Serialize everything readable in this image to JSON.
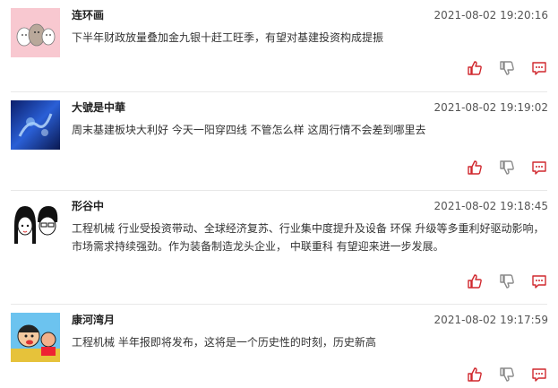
{
  "comments": [
    {
      "user": "连环画",
      "time": "2021-08-02 19:20:16",
      "text": "下半年财政放量叠加金九银十赶工旺季，有望对基建投资构成提振"
    },
    {
      "user": "大號是中華",
      "time": "2021-08-02 19:19:02",
      "text": "周末基建板块大利好 今天一阳穿四线 不管怎么样 这周行情不会差到哪里去"
    },
    {
      "user": "形谷中",
      "time": "2021-08-02 19:18:45",
      "text_line1": "工程机械 行业受投资带动、全球经济复苏、行业集中度提升及设备 环保 升级等多重利好驱动影响，",
      "text_line2": "市场需求持续强劲。作为装备制造龙头企业， 中联重科 有望迎来进一步发展。"
    },
    {
      "user": "康河湾月",
      "time": "2021-08-02 19:17:59",
      "text": "工程机械 半年报即将发布，这将是一个历史性的时刻，历史新高"
    }
  ],
  "icons": {
    "like": "thumbs-up-icon",
    "dislike": "thumbs-down-icon",
    "reply": "comment-icon"
  },
  "colors": {
    "accent": "#d0282e",
    "neutral_icon": "#8a8a8a"
  }
}
